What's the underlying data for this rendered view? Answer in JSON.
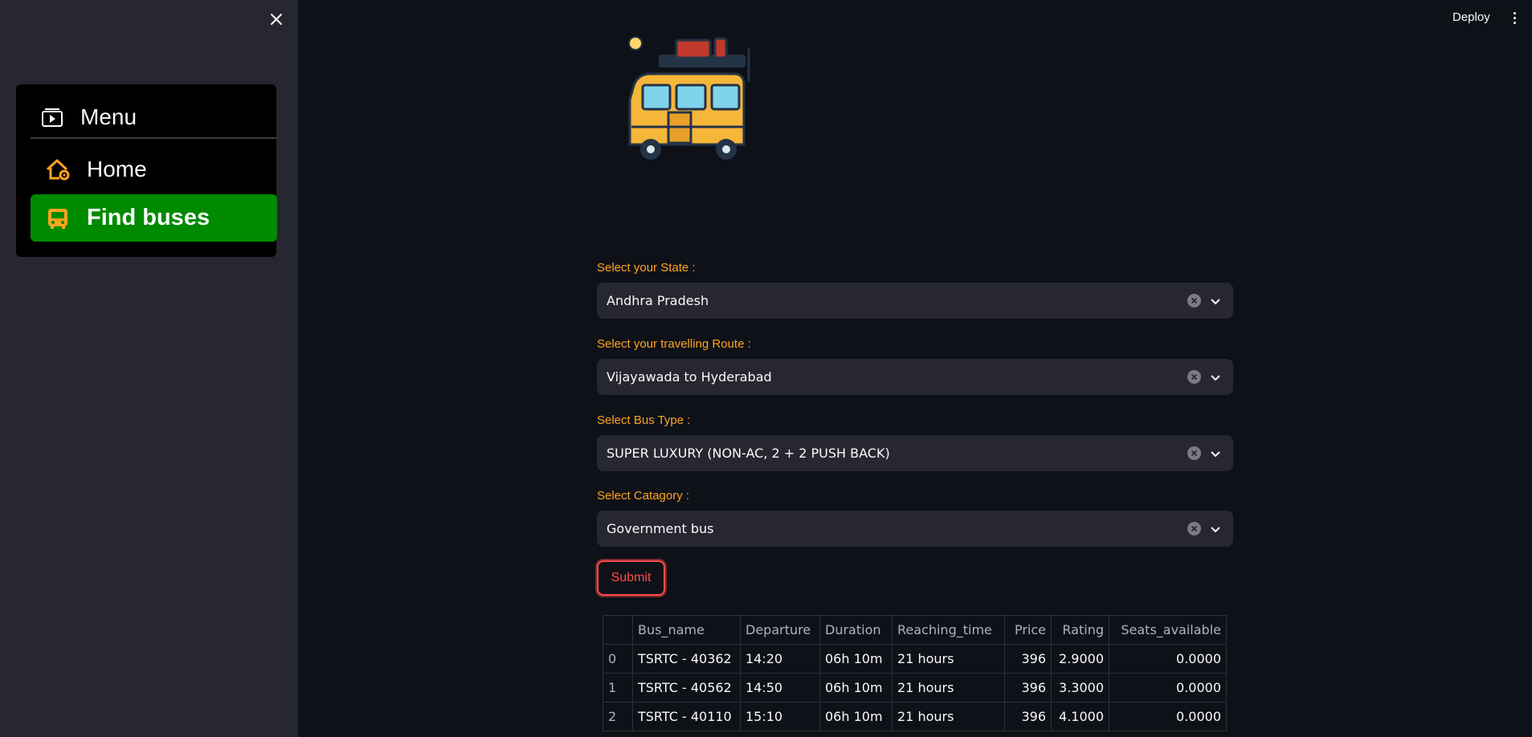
{
  "topbar": {
    "deploy_label": "Deploy"
  },
  "sidebar": {
    "menu_title": "Menu",
    "items": [
      {
        "label": "Home",
        "icon": "house-gear-icon"
      },
      {
        "label": "Find buses",
        "icon": "bus-front-icon",
        "active": true
      }
    ]
  },
  "form": {
    "state": {
      "label": "Select your State :",
      "value": "Andhra Pradesh"
    },
    "route": {
      "label": "Select your travelling Route :",
      "value": "Vijayawada to Hyderabad"
    },
    "bus_type": {
      "label": "Select Bus Type :",
      "value": "SUPER LUXURY (NON-AC, 2 + 2 PUSH BACK)"
    },
    "category": {
      "label": "Select Catagory :",
      "value": "Government bus"
    },
    "submit_label": "Submit"
  },
  "colors": {
    "accent_label": "#ffa421",
    "active_nav": "#008a00",
    "submit_red": "#ff4b4b"
  },
  "table": {
    "columns": [
      "",
      "Bus_name",
      "Departure",
      "Duration",
      "Reaching_time",
      "Price",
      "Rating",
      "Seats_available"
    ],
    "rows": [
      [
        "0",
        "TSRTC - 40362",
        "14:20",
        "06h 10m",
        "21 hours",
        "396",
        "2.9000",
        "0.0000"
      ],
      [
        "1",
        "TSRTC - 40562",
        "14:50",
        "06h 10m",
        "21 hours",
        "396",
        "3.3000",
        "0.0000"
      ],
      [
        "2",
        "TSRTC - 40110",
        "15:10",
        "06h 10m",
        "21 hours",
        "396",
        "4.1000",
        "0.0000"
      ]
    ]
  }
}
